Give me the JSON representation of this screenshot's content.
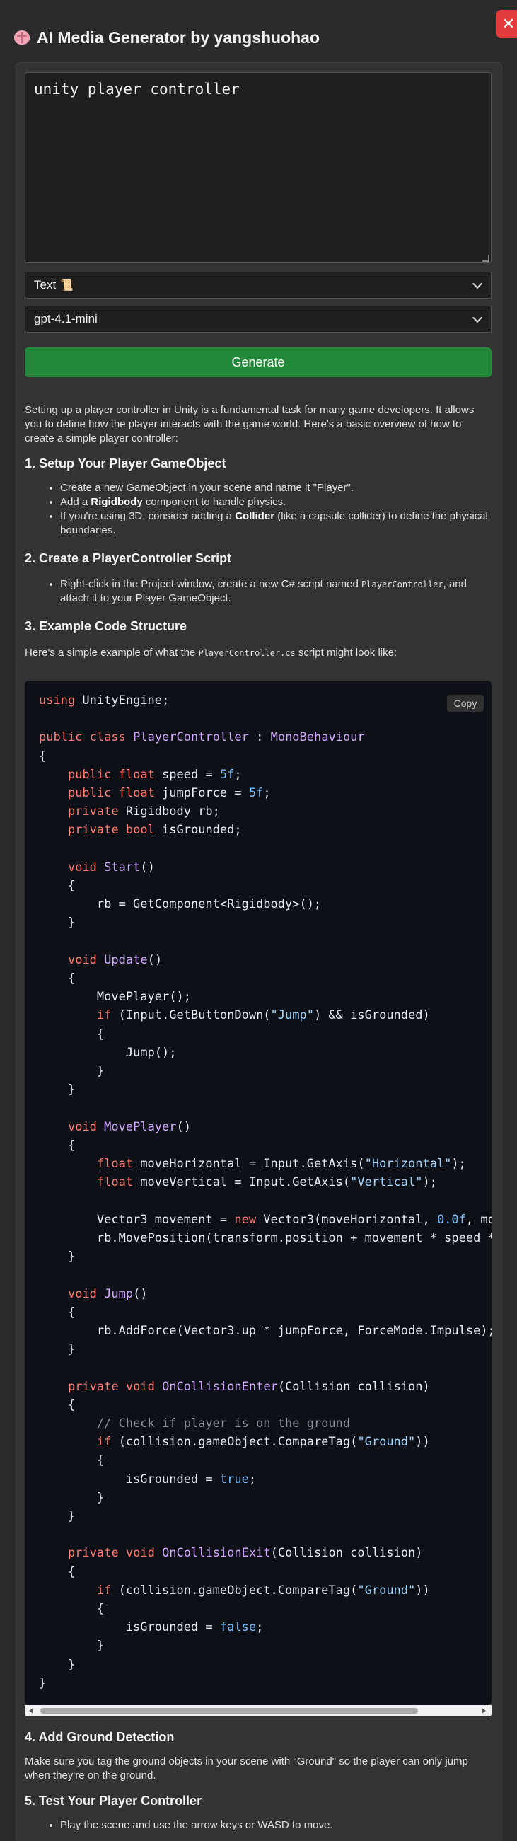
{
  "header": {
    "title": "AI Media Generator by yangshuohao",
    "icon": "brain-icon"
  },
  "close": {
    "label": "✕"
  },
  "prompt": {
    "value": "unity player controller"
  },
  "mode_select": {
    "value": "Text",
    "icon": "scroll-icon"
  },
  "model_select": {
    "value": "gpt-4.1-mini"
  },
  "generate": {
    "label": "Generate"
  },
  "colors": {
    "accent_green": "#24883a",
    "close_red": "#e23b3b",
    "code_bg": "#0d1117"
  },
  "response": {
    "intro": "Setting up a player controller in Unity is a fundamental task for many game developers. It allows you to define how the player interacts with the game world. Here's a basic overview of how to create a simple player controller:",
    "s1": {
      "heading": "1. Setup Your Player GameObject",
      "b1": "Create a new GameObject in your scene and name it \"Player\".",
      "b2_pre": "Add a ",
      "b2_bold": "Rigidbody",
      "b2_post": " component to handle physics.",
      "b3_pre": "If you're using 3D, consider adding a ",
      "b3_bold": "Collider",
      "b3_post": " (like a capsule collider) to define the physical boundaries."
    },
    "s2": {
      "heading": "2. Create a PlayerController Script",
      "b1_pre": "Right-click in the Project window, create a new C# script named ",
      "b1_code": "PlayerController",
      "b1_post": ", and attach it to your Player GameObject."
    },
    "s3": {
      "heading": "3. Example Code Structure",
      "text_pre": "Here's a simple example of what the ",
      "text_code": "PlayerController.cs",
      "text_post": " script might look like:"
    },
    "copy_label": "Copy",
    "s4": {
      "heading": "4. Add Ground Detection",
      "text": "Make sure you tag the ground objects in your scene with \"Ground\" so the player can only jump when they're on the ground."
    },
    "s5": {
      "heading": "5. Test Your Player Controller",
      "b1": "Play the scene and use the arrow keys or WASD to move."
    }
  }
}
